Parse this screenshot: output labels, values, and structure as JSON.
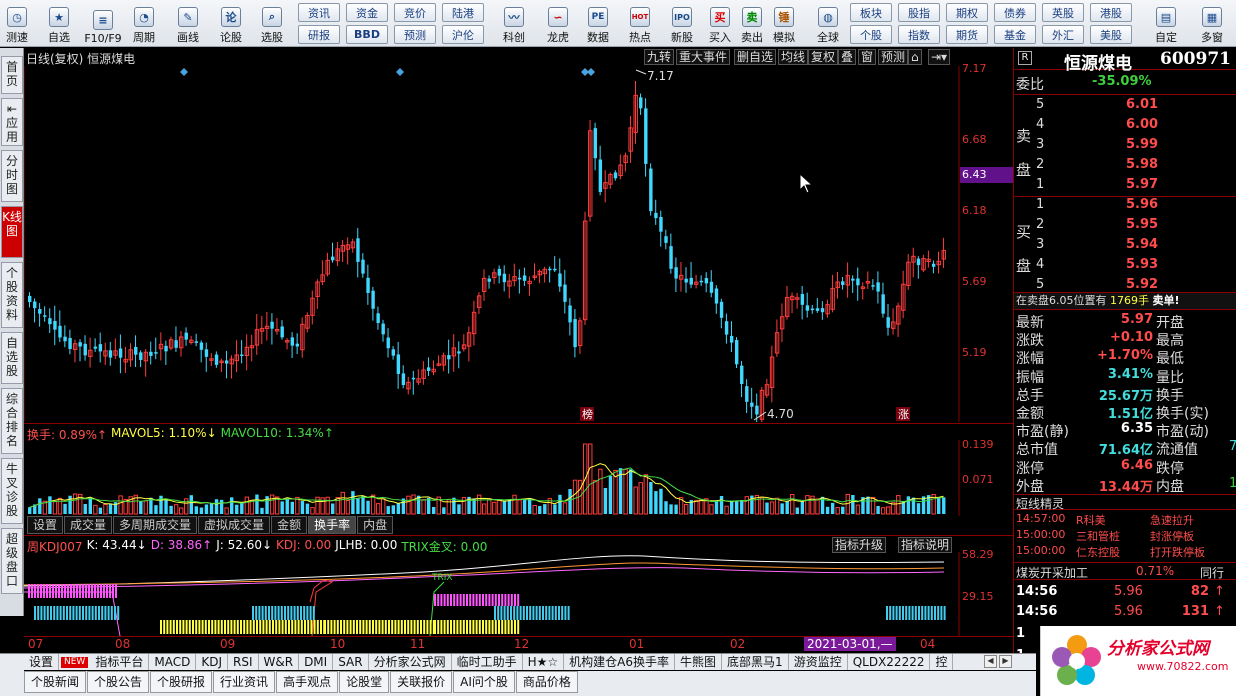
{
  "toolbar": {
    "big": [
      {
        "label": "测速",
        "icon": "clock-icon"
      },
      {
        "label": "自选",
        "icon": "star-icon"
      },
      {
        "label": "F10/F9",
        "icon": "doc-icon"
      },
      {
        "label": "周期",
        "icon": "clock-icon"
      },
      {
        "label": "画线",
        "icon": "pen-icon"
      },
      {
        "label": "论股",
        "icon": "talk-icon",
        "glyph": "论"
      },
      {
        "label": "选股",
        "icon": "magnifier-icon"
      }
    ],
    "small_top": [
      "资讯",
      "资金",
      "竞价",
      "陆港"
    ],
    "small_bottom": [
      "研报",
      "BBD",
      "预测",
      "沪伦"
    ],
    "mid": [
      {
        "label": "科创",
        "icon": "chart-icon"
      },
      {
        "label": "龙虎",
        "icon": "dragon-icon"
      },
      {
        "label": "数据",
        "icon": "pe-icon",
        "glyph": "PE"
      },
      {
        "label": "热点",
        "icon": "hot-icon",
        "glyph": "HOT"
      },
      {
        "label": "新股",
        "icon": "ipo-icon",
        "glyph": "IPO"
      }
    ],
    "trade": [
      {
        "label": "买入",
        "glyph": "买"
      },
      {
        "label": "卖出",
        "glyph": "卖"
      },
      {
        "label": "模拟",
        "glyph": "锤"
      }
    ],
    "global": {
      "label": "全球",
      "icon": "globe-icon"
    },
    "right_top": [
      "板块",
      "股指",
      "期权",
      "债券",
      "英股",
      "港股"
    ],
    "right_bottom": [
      "个股",
      "指数",
      "期货",
      "基金",
      "外汇",
      "美股"
    ],
    "end": [
      {
        "label": "自定",
        "icon": "custom-icon"
      },
      {
        "label": "多窗",
        "icon": "window-icon"
      }
    ]
  },
  "sidetabs": [
    {
      "label": "首页",
      "active": false
    },
    {
      "label": "应用",
      "active": false
    },
    {
      "label": "分时图",
      "active": false
    },
    {
      "label": "K线图",
      "active": true
    },
    {
      "label": "个股资料",
      "active": false
    },
    {
      "label": "自选股",
      "active": false
    },
    {
      "label": "综合排名",
      "active": false
    },
    {
      "label": "牛叉诊股",
      "active": false
    },
    {
      "label": "超级盘口",
      "active": false
    }
  ],
  "chart": {
    "title": "日线(复权) 恒源煤电",
    "head_buttons": [
      "九转",
      "重大事件",
      "删自选",
      "均线",
      "复权",
      "叠",
      "窗",
      "预测"
    ],
    "axis_labels": [
      "7.17",
      "6.68",
      "6.18",
      "5.69",
      "5.19"
    ],
    "current_price": "6.43",
    "high_label": "7.17",
    "low_label": "4.70",
    "markers": [
      "榜",
      "涨"
    ],
    "colors": {
      "up": "#ff3c3c",
      "down": "#40d8ff",
      "grid": "#8a0000"
    }
  },
  "volume": {
    "legend": [
      {
        "text": "换手: 0.89%↑",
        "color": "#ff5050"
      },
      {
        "text": "MAVOL5: 1.10%↓",
        "color": "#ffff44"
      },
      {
        "text": "MAVOL10: 1.34%↑",
        "color": "#44dd44"
      }
    ],
    "axis_labels": [
      "0.139",
      "0.071"
    ],
    "tabs": [
      "设置",
      "成交量",
      "多周期成交量",
      "虚拟成交量",
      "金额",
      "换手率",
      "内盘"
    ],
    "active_tab": "换手率"
  },
  "indicator": {
    "legend": [
      {
        "text": "周KDJ007",
        "color": "#ff5050"
      },
      {
        "text": "K: 43.44↓",
        "color": "#ffffff"
      },
      {
        "text": "D: 38.86↑",
        "color": "#ff66ff"
      },
      {
        "text": "J: 52.60↓",
        "color": "#ffffff"
      },
      {
        "text": "KDJ: 0.00",
        "color": "#ff5050"
      },
      {
        "text": "JLHB: 0.00",
        "color": "#ffffff"
      },
      {
        "text": "TRIX金叉: 0.00",
        "color": "#44dd44"
      }
    ],
    "buttons": [
      "指标升级",
      "指标说明"
    ],
    "axis_labels": [
      "58.29",
      "29.15"
    ],
    "trix_label": "TRIX"
  },
  "dates": {
    "labels": [
      "07",
      "08",
      "09",
      "10",
      "11",
      "12",
      "01",
      "02",
      "04"
    ],
    "highlight": "2021-03-01,—"
  },
  "quote": {
    "name": "恒源煤电",
    "code": "600971",
    "badge": "R",
    "weibi_label": "委比",
    "weibi": "-35.09%",
    "sell_label": "卖盘",
    "buy_label": "买盘",
    "sell": [
      {
        "n": "5",
        "p": "6.01"
      },
      {
        "n": "4",
        "p": "6.00"
      },
      {
        "n": "3",
        "p": "5.99"
      },
      {
        "n": "2",
        "p": "5.98"
      },
      {
        "n": "1",
        "p": "5.97"
      }
    ],
    "buy": [
      {
        "n": "1",
        "p": "5.96"
      },
      {
        "n": "2",
        "p": "5.95"
      },
      {
        "n": "3",
        "p": "5.94"
      },
      {
        "n": "4",
        "p": "5.93"
      },
      {
        "n": "5",
        "p": "5.92"
      }
    ],
    "notice_pre": "在卖盘6.05位置有",
    "notice_vol": "1769手",
    "notice_post": "卖单!",
    "stats": [
      {
        "l": "最新",
        "v": "5.97",
        "vc": "red",
        "r": "开盘"
      },
      {
        "l": "涨跌",
        "v": "+0.10",
        "vc": "red",
        "r": "最高"
      },
      {
        "l": "涨幅",
        "v": "+1.70%",
        "vc": "red",
        "r": "最低"
      },
      {
        "l": "振幅",
        "v": "3.41%",
        "vc": "cyan",
        "r": "量比"
      },
      {
        "l": "总手",
        "v": "25.67万",
        "vc": "cyan",
        "r": "换手"
      },
      {
        "l": "金额",
        "v": "1.51亿",
        "vc": "cyan",
        "r": "换手(实)"
      },
      {
        "l": "市盈(静)",
        "v": "6.35",
        "vc": "wht",
        "r": "市盈(动)"
      },
      {
        "l": "总市值",
        "v": "71.64亿",
        "vc": "cyan",
        "r": "流通值"
      },
      {
        "l": "涨停",
        "v": "6.46",
        "vc": "red",
        "r": "跌停"
      },
      {
        "l": "外盘",
        "v": "13.44万",
        "vc": "red",
        "r": "内盘"
      }
    ],
    "stats_clip": [
      "",
      "",
      "",
      "",
      "",
      "",
      "",
      "7",
      "",
      "1"
    ],
    "sprite_title": "短线精灵",
    "sprites": [
      {
        "t": "14:57:00",
        "n": "R科美",
        "e": "急速拉升"
      },
      {
        "t": "15:00:00",
        "n": "三和管桩",
        "e": "封涨停板"
      },
      {
        "t": "15:00:00",
        "n": "仁东控股",
        "e": "打开跌停板"
      }
    ],
    "sector": "煤炭开采加工",
    "sector_pct": "0.71%",
    "sector_btn": "同行",
    "ticks": [
      {
        "t": "14:56",
        "p": "5.96",
        "v": "82",
        "dir": "↑"
      },
      {
        "t": "14:56",
        "p": "5.96",
        "v": "131",
        "dir": "↑"
      }
    ],
    "tick_side": [
      "1",
      "1"
    ]
  },
  "bottom1": [
    "设置",
    "NEW",
    "指标平台",
    "MACD",
    "KDJ",
    "RSI",
    "W&R",
    "DMI",
    "SAR",
    "分析家公式网",
    "临时工助手",
    "H★☆",
    "机构建仓A6换手率",
    "牛熊图",
    "底部黑马1",
    "游资监控",
    "QLDX22222",
    "控"
  ],
  "bottom2": [
    "个股新闻",
    "个股公告",
    "个股研报",
    "行业资讯",
    "高手观点",
    "论股堂",
    "关联报价",
    "AI问个股",
    "商品价格"
  ],
  "logo": {
    "name": "分析家公式网",
    "url": "www.70822.com"
  }
}
